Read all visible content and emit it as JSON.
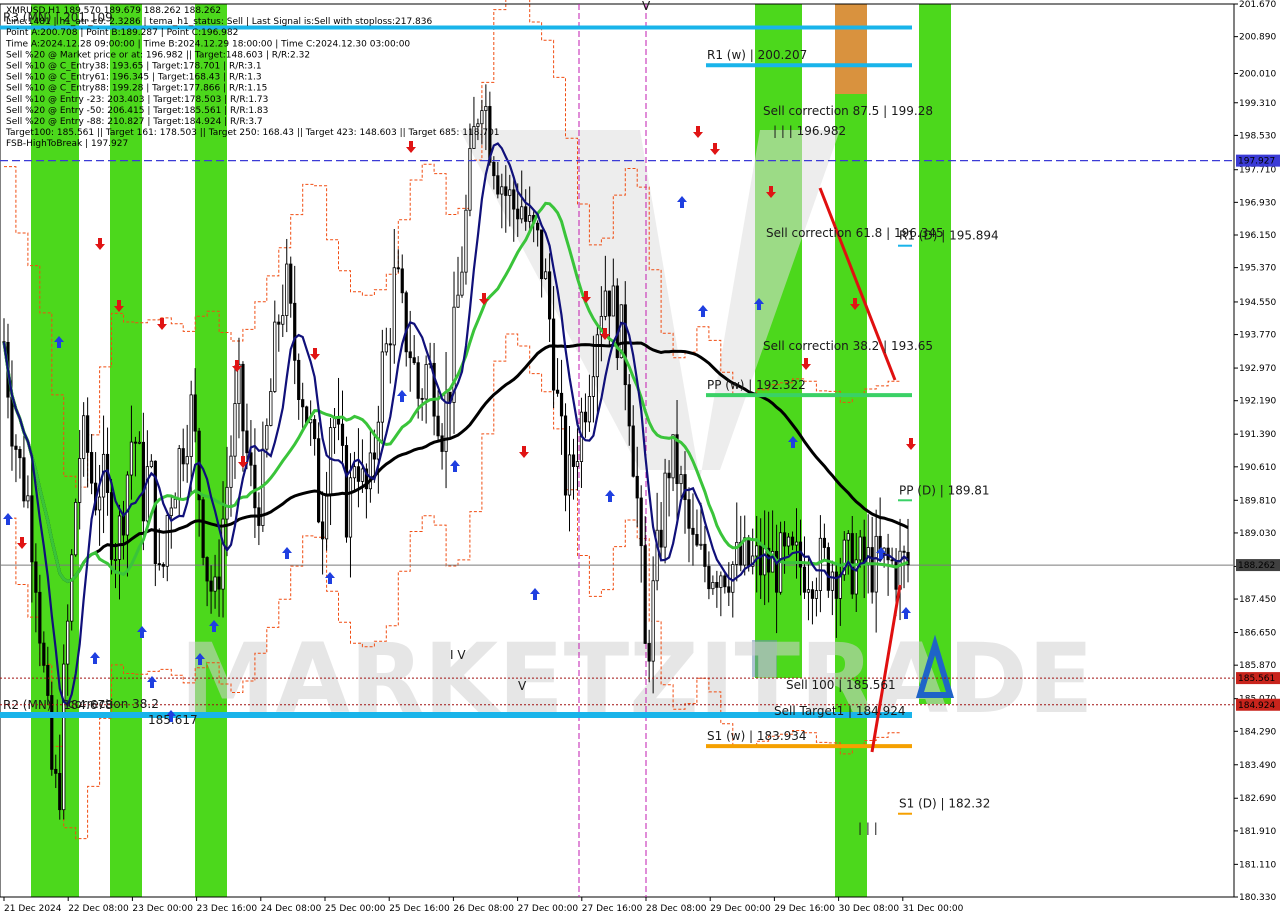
{
  "chart_data": {
    "type": "candlestick",
    "symbol": "XMRUSD",
    "timeframe": "H1",
    "info_lines": [
      "XMRUSD,H1  189.570 189.679 188.262 188.262",
      "Line:1481 | h1_atr_c0: 2.3286 | tema_h1_status: Sell | Last Signal is:Sell with stoploss:217.836",
      "Point A:200.708 | Point B:189.287 | Point C:196.982",
      "Time A:2024.12.28 09:00:00 | Time B:2024.12.29 18:00:00 | Time C:2024.12.30 03:00:00",
      "Sell %20 @ Market price or at: 196.982 || Target:148.603 | R/R:2.32",
      "Sell %10 @ C_Entry38: 193.65 | Target:178.701 | R/R:3.1",
      "Sell %10 @ C_Entry61: 196.345 | Target:168.43 | R/R:1.3",
      "Sell %10 @ C_Entry88: 199.28 | Target:177.866 | R/R:1.15",
      "Sell %10 @ Entry -23: 203.403 | Target:178.503 | R/R:1.73",
      "Sell %20 @ Entry -50: 206.415 | Target:185.561 | R/R:1.83",
      "Sell %20 @ Entry -88: 210.827 | Target:184.924 | R/R:3.7",
      "Target100: 185.561 || Target 161: 178.503 || Target 250: 168.43 || Target 423: 148.603 || Target 685: 118.701",
      "FSB-HighToBreak | 197.927"
    ],
    "y_axis": {
      "min": 180.33,
      "max": 201.67,
      "ticks": [
        "201.670",
        "200.890",
        "200.010",
        "199.310",
        "198.530",
        "197.710",
        "196.930",
        "196.150",
        "195.370",
        "194.550",
        "193.770",
        "192.970",
        "192.190",
        "191.390",
        "190.610",
        "189.810",
        "189.030",
        "188.230",
        "187.450",
        "186.650",
        "185.870",
        "185.070",
        "184.290",
        "183.490",
        "182.690",
        "181.910",
        "181.110",
        "180.330"
      ]
    },
    "x_axis": {
      "ticks": [
        "21 Dec 2024",
        "22 Dec 08:00",
        "23 Dec 00:00",
        "23 Dec 16:00",
        "24 Dec 08:00",
        "25 Dec 00:00",
        "25 Dec 16:00",
        "26 Dec 08:00",
        "27 Dec 00:00",
        "27 Dec 16:00",
        "28 Dec 08:00",
        "29 Dec 00:00",
        "29 Dec 16:00",
        "30 Dec 08:00",
        "31 Dec 00:00"
      ]
    },
    "price_tags": [
      {
        "value": 197.927,
        "text": "197.927",
        "color": "#3b3bd6"
      },
      {
        "value": 188.262,
        "text": "188.262",
        "color": "#404040"
      },
      {
        "value": 185.561,
        "text": "185.561",
        "color": "#c8241c"
      },
      {
        "value": 184.924,
        "text": "184.924",
        "color": "#c8241c"
      }
    ],
    "levels": [
      {
        "value": 201.109,
        "label": "R3 (MN) | 201.109",
        "color": "#19b4ea"
      },
      {
        "value": 200.207,
        "label": "R1 (w) | 200.207",
        "color": "#19b4ea"
      },
      {
        "value": 195.894,
        "label": "R1 (D) | 195.894",
        "color": "#19b4ea"
      },
      {
        "value": 192.322,
        "label": "PP (w) | 192.322",
        "color": "#3ad166"
      },
      {
        "value": 189.81,
        "label": "PP (D) | 189.81",
        "color": "#3ad166"
      },
      {
        "value": 184.678,
        "label": "R2 (MN) | 184.678",
        "color": "#19b4ea"
      },
      {
        "value": 183.934,
        "label": "S1 (w) | 183.934",
        "color": "#f5a000"
      },
      {
        "value": 182.32,
        "label": "S1 (D) | 182.32",
        "color": "#f5a000"
      }
    ],
    "annotations": [
      {
        "text": "Sell correction 87.5 | 199.28"
      },
      {
        "text": "| | | 196.982"
      },
      {
        "text": "Sell correction 61.8 | 196.345"
      },
      {
        "text": "Sell correction 38.2 | 193.65"
      },
      {
        "text": "Sell 100 | 185.561"
      },
      {
        "text": "Sell Target1 | 184.924"
      },
      {
        "text": "correction 38.2"
      },
      {
        "text": "185.617"
      },
      {
        "text": "| | |"
      },
      {
        "text": "I V"
      },
      {
        "text": "V"
      },
      {
        "text": "V"
      }
    ],
    "watermark": "MARKETZITRADE",
    "colors": {
      "zone_green": "#4cd81c",
      "zone_orange": "#d9923e",
      "ma_black": "#000000",
      "ma_green": "#3ac43a",
      "ma_navy": "#10107a",
      "bands": "#f04d12",
      "up_arrow": "#1f3fe0",
      "down_arrow": "#e01414",
      "fsb_line": "#3b3bd6"
    },
    "series": [
      {
        "name": "price",
        "x": [
          0,
          4,
          8,
          12,
          16,
          20,
          24,
          28,
          30,
          34,
          38,
          42,
          46,
          50,
          54,
          58,
          62,
          66,
          70,
          72,
          74,
          76,
          78,
          80,
          84,
          88,
          92,
          96,
          100,
          104,
          108,
          112,
          116,
          120,
          124,
          128,
          132,
          136,
          140,
          144,
          148,
          152,
          156,
          160,
          162,
          164,
          166,
          168,
          170,
          172,
          174,
          176,
          178,
          180,
          184,
          188,
          192,
          196,
          200,
          204,
          208,
          212,
          216,
          220,
          224,
          228,
          232,
          236,
          240,
          244,
          248,
          252,
          256,
          260,
          264,
          268,
          272,
          276,
          280,
          284,
          288,
          292,
          296,
          300,
          304,
          308,
          312,
          316,
          320,
          324,
          328,
          332,
          336,
          340,
          344,
          348,
          352,
          356,
          360,
          364,
          368,
          372,
          376,
          380,
          384,
          388,
          392,
          396,
          400,
          404,
          408,
          412,
          416,
          420,
          424,
          428,
          432,
          436,
          440,
          444,
          448,
          452,
          456,
          460,
          464
        ],
        "close": [
          193.6,
          191.8,
          190.6,
          189.9,
          188.4,
          185.8,
          183.4,
          182.5,
          184.9,
          187.8,
          190.9,
          191.2,
          189.9,
          190.4,
          189.3,
          188.7,
          190.1,
          191.6,
          190.3,
          189.6,
          190.8,
          189.9,
          188.5,
          187.4,
          189.8,
          190.5,
          191.4,
          192.0,
          189.9,
          188.1,
          187.3,
          189.4,
          191.0,
          192.3,
          190.9,
          189.7,
          190.1,
          192.2,
          194.1,
          195.0,
          193.4,
          192.6,
          191.6,
          190.2,
          189.0,
          190.2,
          191.4,
          192.3,
          191.2,
          190.8,
          190.0,
          189.2,
          190.7,
          191.2,
          189.8,
          190.3,
          192.7,
          193.5,
          195.2,
          194.0,
          193.4,
          192.2,
          193.0,
          192.6,
          191.6,
          192.7,
          194.6,
          196.5,
          198.4,
          199.9,
          198.6,
          197.8,
          197.2,
          196.8,
          197.0,
          196.2,
          196.0,
          195.2,
          193.7,
          191.4,
          190.0,
          191.0,
          192.0,
          193.2,
          194.4,
          195.1,
          194.2,
          193.6,
          192.0,
          189.5,
          185.8,
          187.6,
          189.3,
          190.8,
          190.5,
          189.5,
          188.6,
          188.3,
          188.26,
          188.26,
          188.26,
          188.26,
          188.26,
          188.26,
          188.26,
          188.26,
          188.26,
          188.26,
          188.26,
          188.26,
          188.26,
          188.26,
          188.26,
          188.26,
          188.26,
          188.26,
          188.26,
          188.26,
          188.26,
          188.26,
          188.26,
          188.26,
          188.26,
          188.26,
          188.26
        ]
      }
    ]
  }
}
